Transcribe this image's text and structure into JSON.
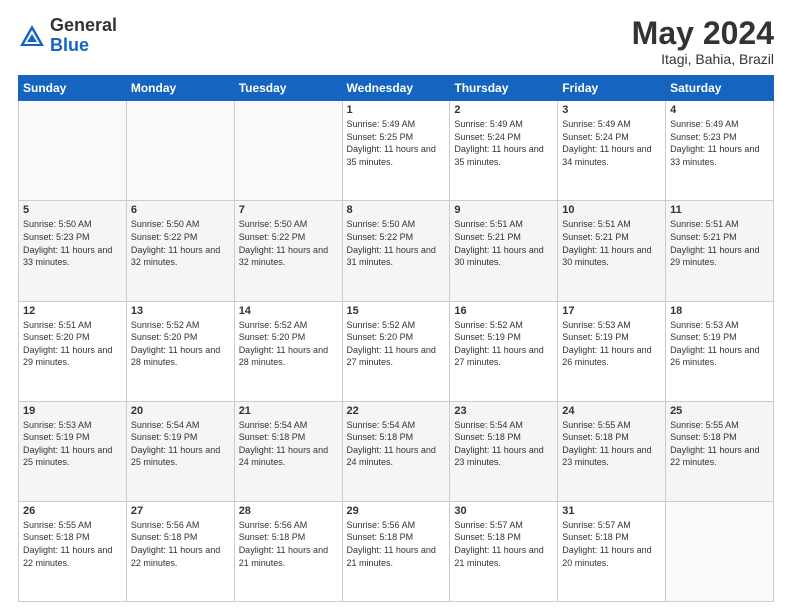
{
  "logo": {
    "general": "General",
    "blue": "Blue"
  },
  "header": {
    "month": "May 2024",
    "location": "Itagi, Bahia, Brazil"
  },
  "weekdays": [
    "Sunday",
    "Monday",
    "Tuesday",
    "Wednesday",
    "Thursday",
    "Friday",
    "Saturday"
  ],
  "weeks": [
    [
      {
        "day": "",
        "sunrise": "",
        "sunset": "",
        "daylight": ""
      },
      {
        "day": "",
        "sunrise": "",
        "sunset": "",
        "daylight": ""
      },
      {
        "day": "",
        "sunrise": "",
        "sunset": "",
        "daylight": ""
      },
      {
        "day": "1",
        "sunrise": "Sunrise: 5:49 AM",
        "sunset": "Sunset: 5:25 PM",
        "daylight": "Daylight: 11 hours and 35 minutes."
      },
      {
        "day": "2",
        "sunrise": "Sunrise: 5:49 AM",
        "sunset": "Sunset: 5:24 PM",
        "daylight": "Daylight: 11 hours and 35 minutes."
      },
      {
        "day": "3",
        "sunrise": "Sunrise: 5:49 AM",
        "sunset": "Sunset: 5:24 PM",
        "daylight": "Daylight: 11 hours and 34 minutes."
      },
      {
        "day": "4",
        "sunrise": "Sunrise: 5:49 AM",
        "sunset": "Sunset: 5:23 PM",
        "daylight": "Daylight: 11 hours and 33 minutes."
      }
    ],
    [
      {
        "day": "5",
        "sunrise": "Sunrise: 5:50 AM",
        "sunset": "Sunset: 5:23 PM",
        "daylight": "Daylight: 11 hours and 33 minutes."
      },
      {
        "day": "6",
        "sunrise": "Sunrise: 5:50 AM",
        "sunset": "Sunset: 5:22 PM",
        "daylight": "Daylight: 11 hours and 32 minutes."
      },
      {
        "day": "7",
        "sunrise": "Sunrise: 5:50 AM",
        "sunset": "Sunset: 5:22 PM",
        "daylight": "Daylight: 11 hours and 32 minutes."
      },
      {
        "day": "8",
        "sunrise": "Sunrise: 5:50 AM",
        "sunset": "Sunset: 5:22 PM",
        "daylight": "Daylight: 11 hours and 31 minutes."
      },
      {
        "day": "9",
        "sunrise": "Sunrise: 5:51 AM",
        "sunset": "Sunset: 5:21 PM",
        "daylight": "Daylight: 11 hours and 30 minutes."
      },
      {
        "day": "10",
        "sunrise": "Sunrise: 5:51 AM",
        "sunset": "Sunset: 5:21 PM",
        "daylight": "Daylight: 11 hours and 30 minutes."
      },
      {
        "day": "11",
        "sunrise": "Sunrise: 5:51 AM",
        "sunset": "Sunset: 5:21 PM",
        "daylight": "Daylight: 11 hours and 29 minutes."
      }
    ],
    [
      {
        "day": "12",
        "sunrise": "Sunrise: 5:51 AM",
        "sunset": "Sunset: 5:20 PM",
        "daylight": "Daylight: 11 hours and 29 minutes."
      },
      {
        "day": "13",
        "sunrise": "Sunrise: 5:52 AM",
        "sunset": "Sunset: 5:20 PM",
        "daylight": "Daylight: 11 hours and 28 minutes."
      },
      {
        "day": "14",
        "sunrise": "Sunrise: 5:52 AM",
        "sunset": "Sunset: 5:20 PM",
        "daylight": "Daylight: 11 hours and 28 minutes."
      },
      {
        "day": "15",
        "sunrise": "Sunrise: 5:52 AM",
        "sunset": "Sunset: 5:20 PM",
        "daylight": "Daylight: 11 hours and 27 minutes."
      },
      {
        "day": "16",
        "sunrise": "Sunrise: 5:52 AM",
        "sunset": "Sunset: 5:19 PM",
        "daylight": "Daylight: 11 hours and 27 minutes."
      },
      {
        "day": "17",
        "sunrise": "Sunrise: 5:53 AM",
        "sunset": "Sunset: 5:19 PM",
        "daylight": "Daylight: 11 hours and 26 minutes."
      },
      {
        "day": "18",
        "sunrise": "Sunrise: 5:53 AM",
        "sunset": "Sunset: 5:19 PM",
        "daylight": "Daylight: 11 hours and 26 minutes."
      }
    ],
    [
      {
        "day": "19",
        "sunrise": "Sunrise: 5:53 AM",
        "sunset": "Sunset: 5:19 PM",
        "daylight": "Daylight: 11 hours and 25 minutes."
      },
      {
        "day": "20",
        "sunrise": "Sunrise: 5:54 AM",
        "sunset": "Sunset: 5:19 PM",
        "daylight": "Daylight: 11 hours and 25 minutes."
      },
      {
        "day": "21",
        "sunrise": "Sunrise: 5:54 AM",
        "sunset": "Sunset: 5:18 PM",
        "daylight": "Daylight: 11 hours and 24 minutes."
      },
      {
        "day": "22",
        "sunrise": "Sunrise: 5:54 AM",
        "sunset": "Sunset: 5:18 PM",
        "daylight": "Daylight: 11 hours and 24 minutes."
      },
      {
        "day": "23",
        "sunrise": "Sunrise: 5:54 AM",
        "sunset": "Sunset: 5:18 PM",
        "daylight": "Daylight: 11 hours and 23 minutes."
      },
      {
        "day": "24",
        "sunrise": "Sunrise: 5:55 AM",
        "sunset": "Sunset: 5:18 PM",
        "daylight": "Daylight: 11 hours and 23 minutes."
      },
      {
        "day": "25",
        "sunrise": "Sunrise: 5:55 AM",
        "sunset": "Sunset: 5:18 PM",
        "daylight": "Daylight: 11 hours and 22 minutes."
      }
    ],
    [
      {
        "day": "26",
        "sunrise": "Sunrise: 5:55 AM",
        "sunset": "Sunset: 5:18 PM",
        "daylight": "Daylight: 11 hours and 22 minutes."
      },
      {
        "day": "27",
        "sunrise": "Sunrise: 5:56 AM",
        "sunset": "Sunset: 5:18 PM",
        "daylight": "Daylight: 11 hours and 22 minutes."
      },
      {
        "day": "28",
        "sunrise": "Sunrise: 5:56 AM",
        "sunset": "Sunset: 5:18 PM",
        "daylight": "Daylight: 11 hours and 21 minutes."
      },
      {
        "day": "29",
        "sunrise": "Sunrise: 5:56 AM",
        "sunset": "Sunset: 5:18 PM",
        "daylight": "Daylight: 11 hours and 21 minutes."
      },
      {
        "day": "30",
        "sunrise": "Sunrise: 5:57 AM",
        "sunset": "Sunset: 5:18 PM",
        "daylight": "Daylight: 11 hours and 21 minutes."
      },
      {
        "day": "31",
        "sunrise": "Sunrise: 5:57 AM",
        "sunset": "Sunset: 5:18 PM",
        "daylight": "Daylight: 11 hours and 20 minutes."
      },
      {
        "day": "",
        "sunrise": "",
        "sunset": "",
        "daylight": ""
      }
    ]
  ]
}
